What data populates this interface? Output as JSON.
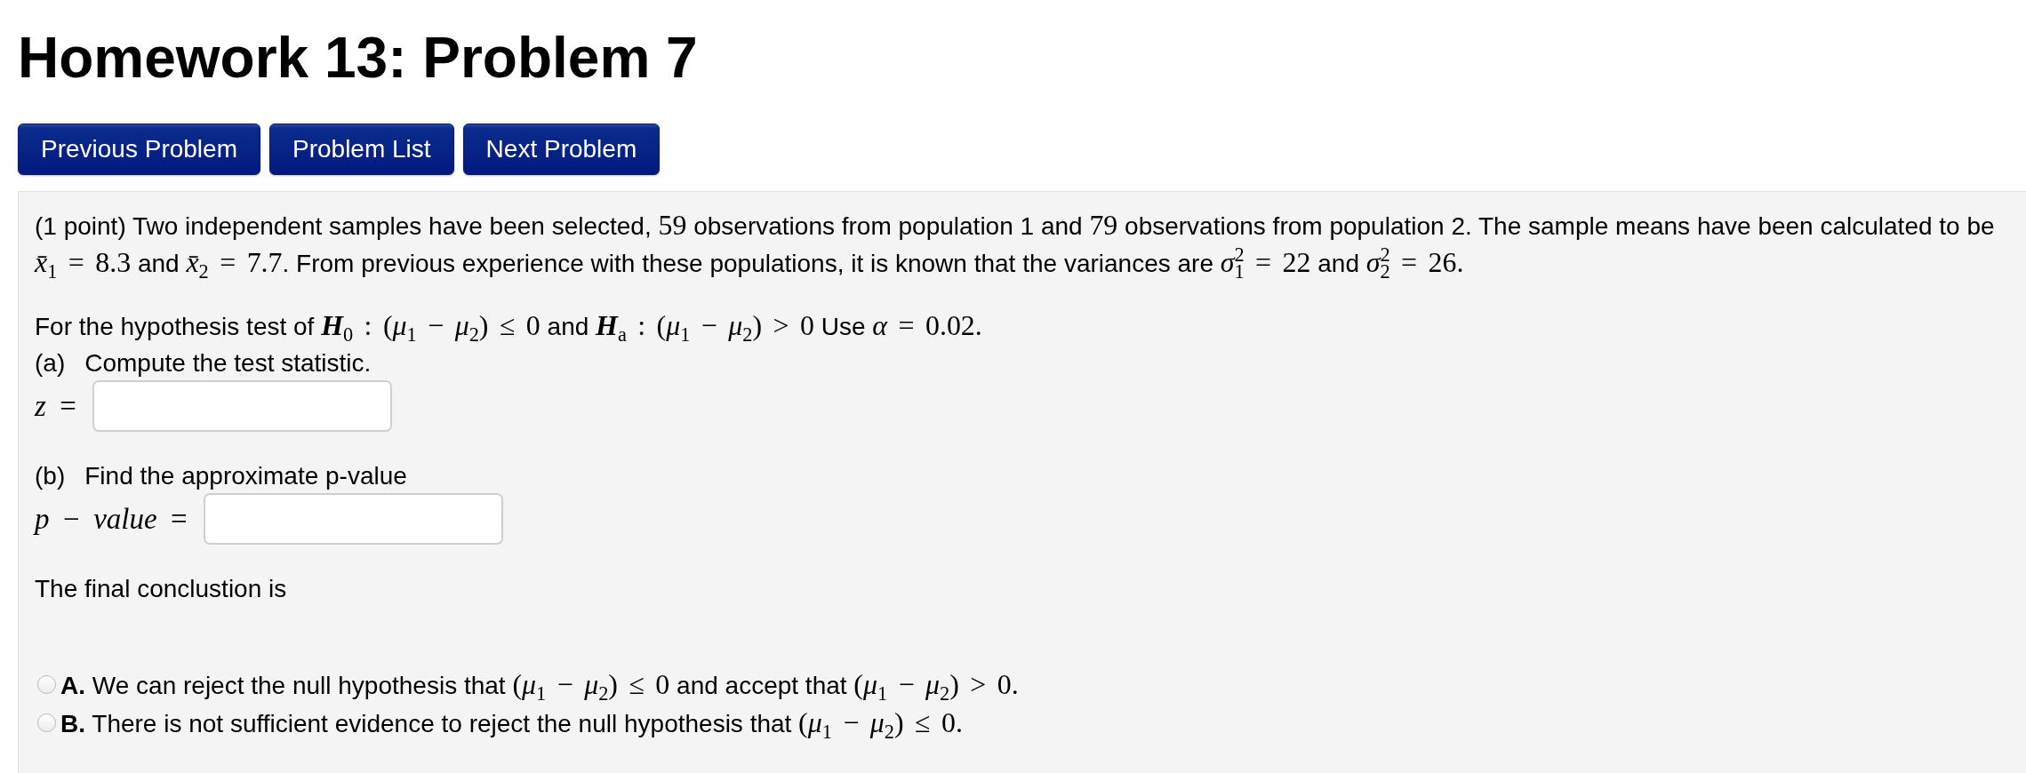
{
  "page_title": "Homework 13: Problem 7",
  "nav_buttons": [
    {
      "label": "Previous Problem"
    },
    {
      "label": "Problem List"
    },
    {
      "label": "Next Problem"
    }
  ],
  "problem": {
    "intro": [
      {
        "kind": "text",
        "text": "(1 point) Two independent samples have been selected, "
      },
      {
        "kind": "math",
        "text": "59"
      },
      {
        "kind": "text",
        "text": " observations from population 1 and "
      },
      {
        "kind": "math",
        "text": "79"
      },
      {
        "kind": "text",
        "text": " observations from population 2. The sample means have been calculated to be "
      },
      {
        "kind": "math",
        "text": "*x̄*$_{1}$ = 8.3"
      },
      {
        "kind": "text",
        "text": " and "
      },
      {
        "kind": "math",
        "text": "*x̄*$_{2}$ = 7.7"
      },
      {
        "kind": "text",
        "text": ". From previous experience with these populations, it is known that the variances are "
      },
      {
        "kind": "math",
        "text": "*σ*$^{2}$$_{1}$ = 22"
      },
      {
        "kind": "text",
        "text": " and "
      },
      {
        "kind": "math",
        "text": "*σ*$^{2}$$_{2}$ = 26."
      }
    ],
    "hypothesis": [
      {
        "kind": "text",
        "text": "For the hypothesis test of "
      },
      {
        "kind": "math",
        "text": "**H**$_{0}$ : (*μ*$_{1}$ − *μ*$_{2}$) ≤ 0"
      },
      {
        "kind": "text",
        "text": " and "
      },
      {
        "kind": "math",
        "text": "**H**$_{a}$ : (*μ*$_{1}$ − *μ*$_{2}$) > 0"
      },
      {
        "kind": "text",
        "text": " Use "
      },
      {
        "kind": "math",
        "text": "*α* = 0.02."
      }
    ],
    "parts": [
      {
        "label": "(a)",
        "prompt": "Compute the test statistic.",
        "answer_label": "*z* ="
      },
      {
        "label": "(b)",
        "prompt": "Find the approximate p-value",
        "answer_label": "*p* − *value* ="
      }
    ],
    "conclusion": {
      "prompt": "The final conclustion is",
      "choices": [
        {
          "letter": "A.",
          "selected": false,
          "text": [
            {
              "kind": "text",
              "text": "We can reject the null hypothesis that "
            },
            {
              "kind": "math",
              "text": "(*μ*$_{1}$ − *μ*$_{2}$) ≤ 0"
            },
            {
              "kind": "text",
              "text": " and accept that "
            },
            {
              "kind": "math",
              "text": "(*μ*$_{1}$ − *μ*$_{2}$) > 0."
            }
          ]
        },
        {
          "letter": "B.",
          "selected": false,
          "text": [
            {
              "kind": "text",
              "text": "There is not sufficient evidence to reject the null hypothesis that "
            },
            {
              "kind": "math",
              "text": "(*μ*$_{1}$ − *μ*$_{2}$) ≤ 0."
            }
          ]
        }
      ]
    }
  }
}
